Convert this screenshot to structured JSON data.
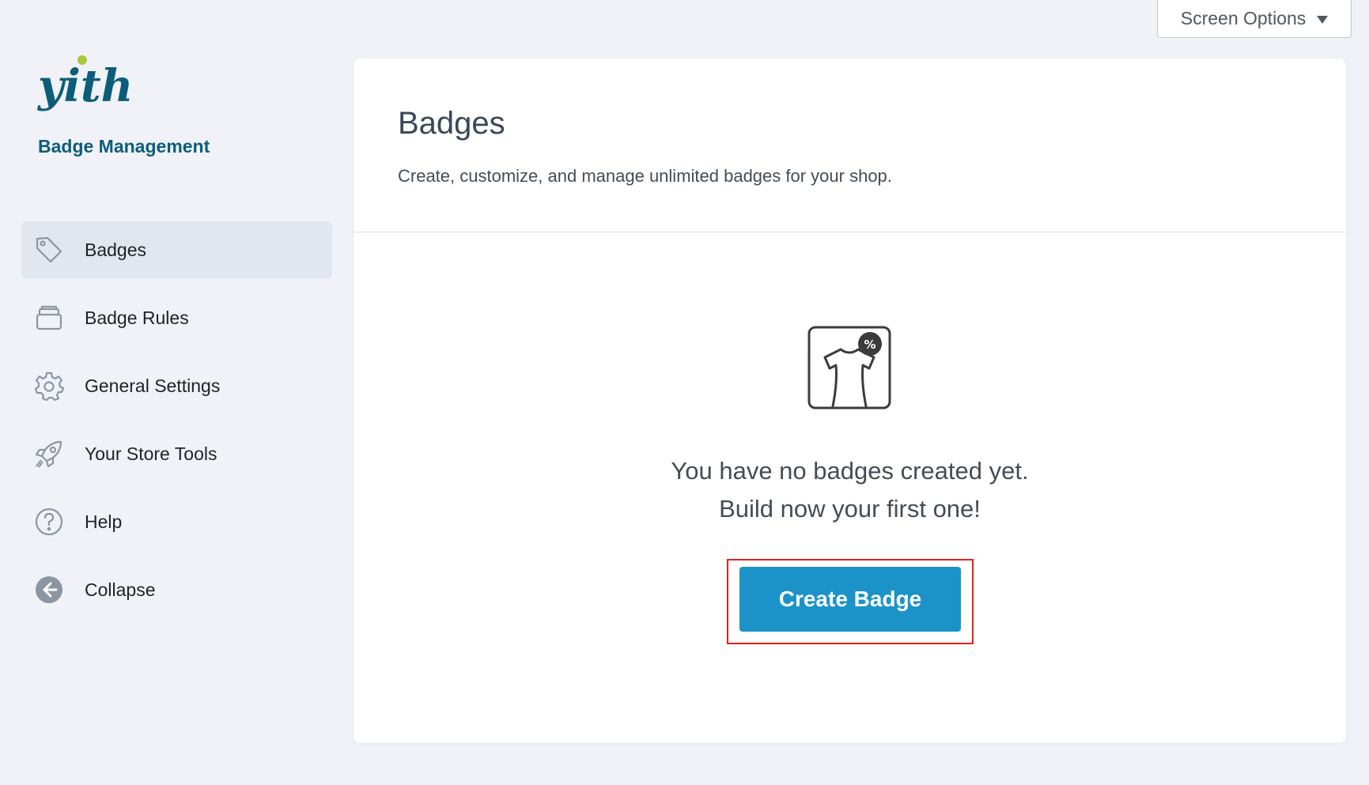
{
  "screen_options": {
    "label": "Screen Options"
  },
  "sidebar": {
    "brand": "yith",
    "plugin_name": "Badge Management",
    "items": [
      {
        "label": "Badges",
        "icon": "tag-icon",
        "active": true
      },
      {
        "label": "Badge Rules",
        "icon": "stack-icon",
        "active": false
      },
      {
        "label": "General Settings",
        "icon": "gear-icon",
        "active": false
      },
      {
        "label": "Your Store Tools",
        "icon": "rocket-icon",
        "active": false
      },
      {
        "label": "Help",
        "icon": "help-icon",
        "active": false
      },
      {
        "label": "Collapse",
        "icon": "collapse-arrow-icon",
        "active": false
      }
    ]
  },
  "main": {
    "title": "Badges",
    "description": "Create, customize, and manage unlimited badges for your shop.",
    "empty_state": {
      "line1": "You have no badges created yet.",
      "line2": "Build now your first one!",
      "icon": "shirt-badge-icon",
      "badge_symbol": "%",
      "button_label": "Create Badge"
    }
  },
  "colors": {
    "background": "#f0f2f7",
    "brand_blue": "#0d5d7a",
    "brand_green": "#a5c93a",
    "primary_button": "#1c93c8",
    "highlight_box": "#e2231a",
    "active_nav": "#e2e6ee"
  }
}
